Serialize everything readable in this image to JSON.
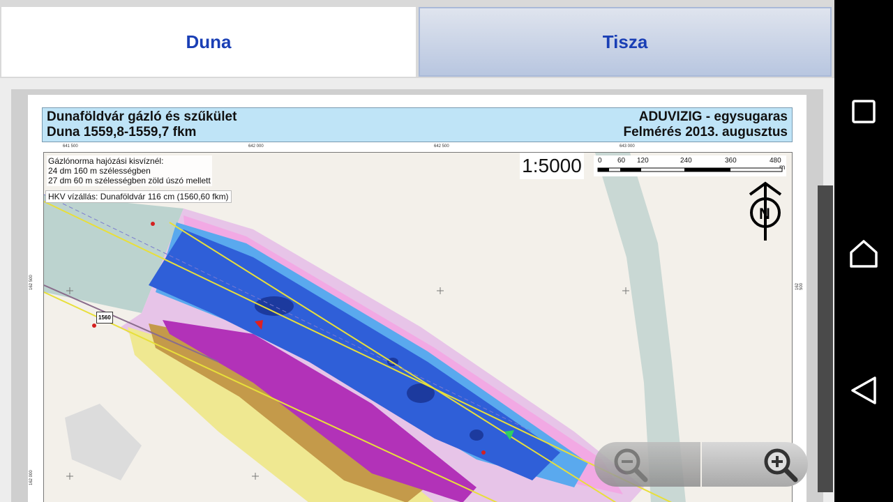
{
  "tabs": [
    {
      "label": "Duna",
      "selected": true
    },
    {
      "label": "Tisza",
      "selected": false
    }
  ],
  "map": {
    "title_left_1": "Dunaföldvár gázló és szűkület",
    "title_left_2": "Duna 1559,8-1559,7 fkm",
    "title_right_1": "ADUVIZIG - egysugaras",
    "title_right_2": "Felmérés 2013. augusztus",
    "info_lines": [
      "Gázlónorma hajózási kisvíznél:",
      "24 dm 160 m szélességben",
      "27 dm 60 m szélességben zöld úszó mellett"
    ],
    "hkv": "HKV vízállás: Dunaföldvár 116 cm (1560,60 fkm)",
    "scale": "1:5000",
    "scalebar_labels": [
      "0",
      "60",
      "120",
      "240",
      "360",
      "480"
    ],
    "scalebar_unit": "m",
    "km_marker": "1560",
    "north_label": "N",
    "top_coords": [
      "641 500",
      "642 000",
      "642 500",
      "643 000"
    ],
    "side_coords": [
      "162 500",
      "162 000",
      "162 500"
    ]
  },
  "zoom": {
    "out_icon": "zoom-out-icon",
    "in_icon": "zoom-in-icon"
  },
  "navbar": {
    "icons": [
      "recents-icon",
      "home-icon",
      "back-icon"
    ]
  },
  "colors": {
    "tab_text": "#1a3fb5",
    "title_bg": "#bfe4f7",
    "river_deep": "#2f5fd8"
  }
}
